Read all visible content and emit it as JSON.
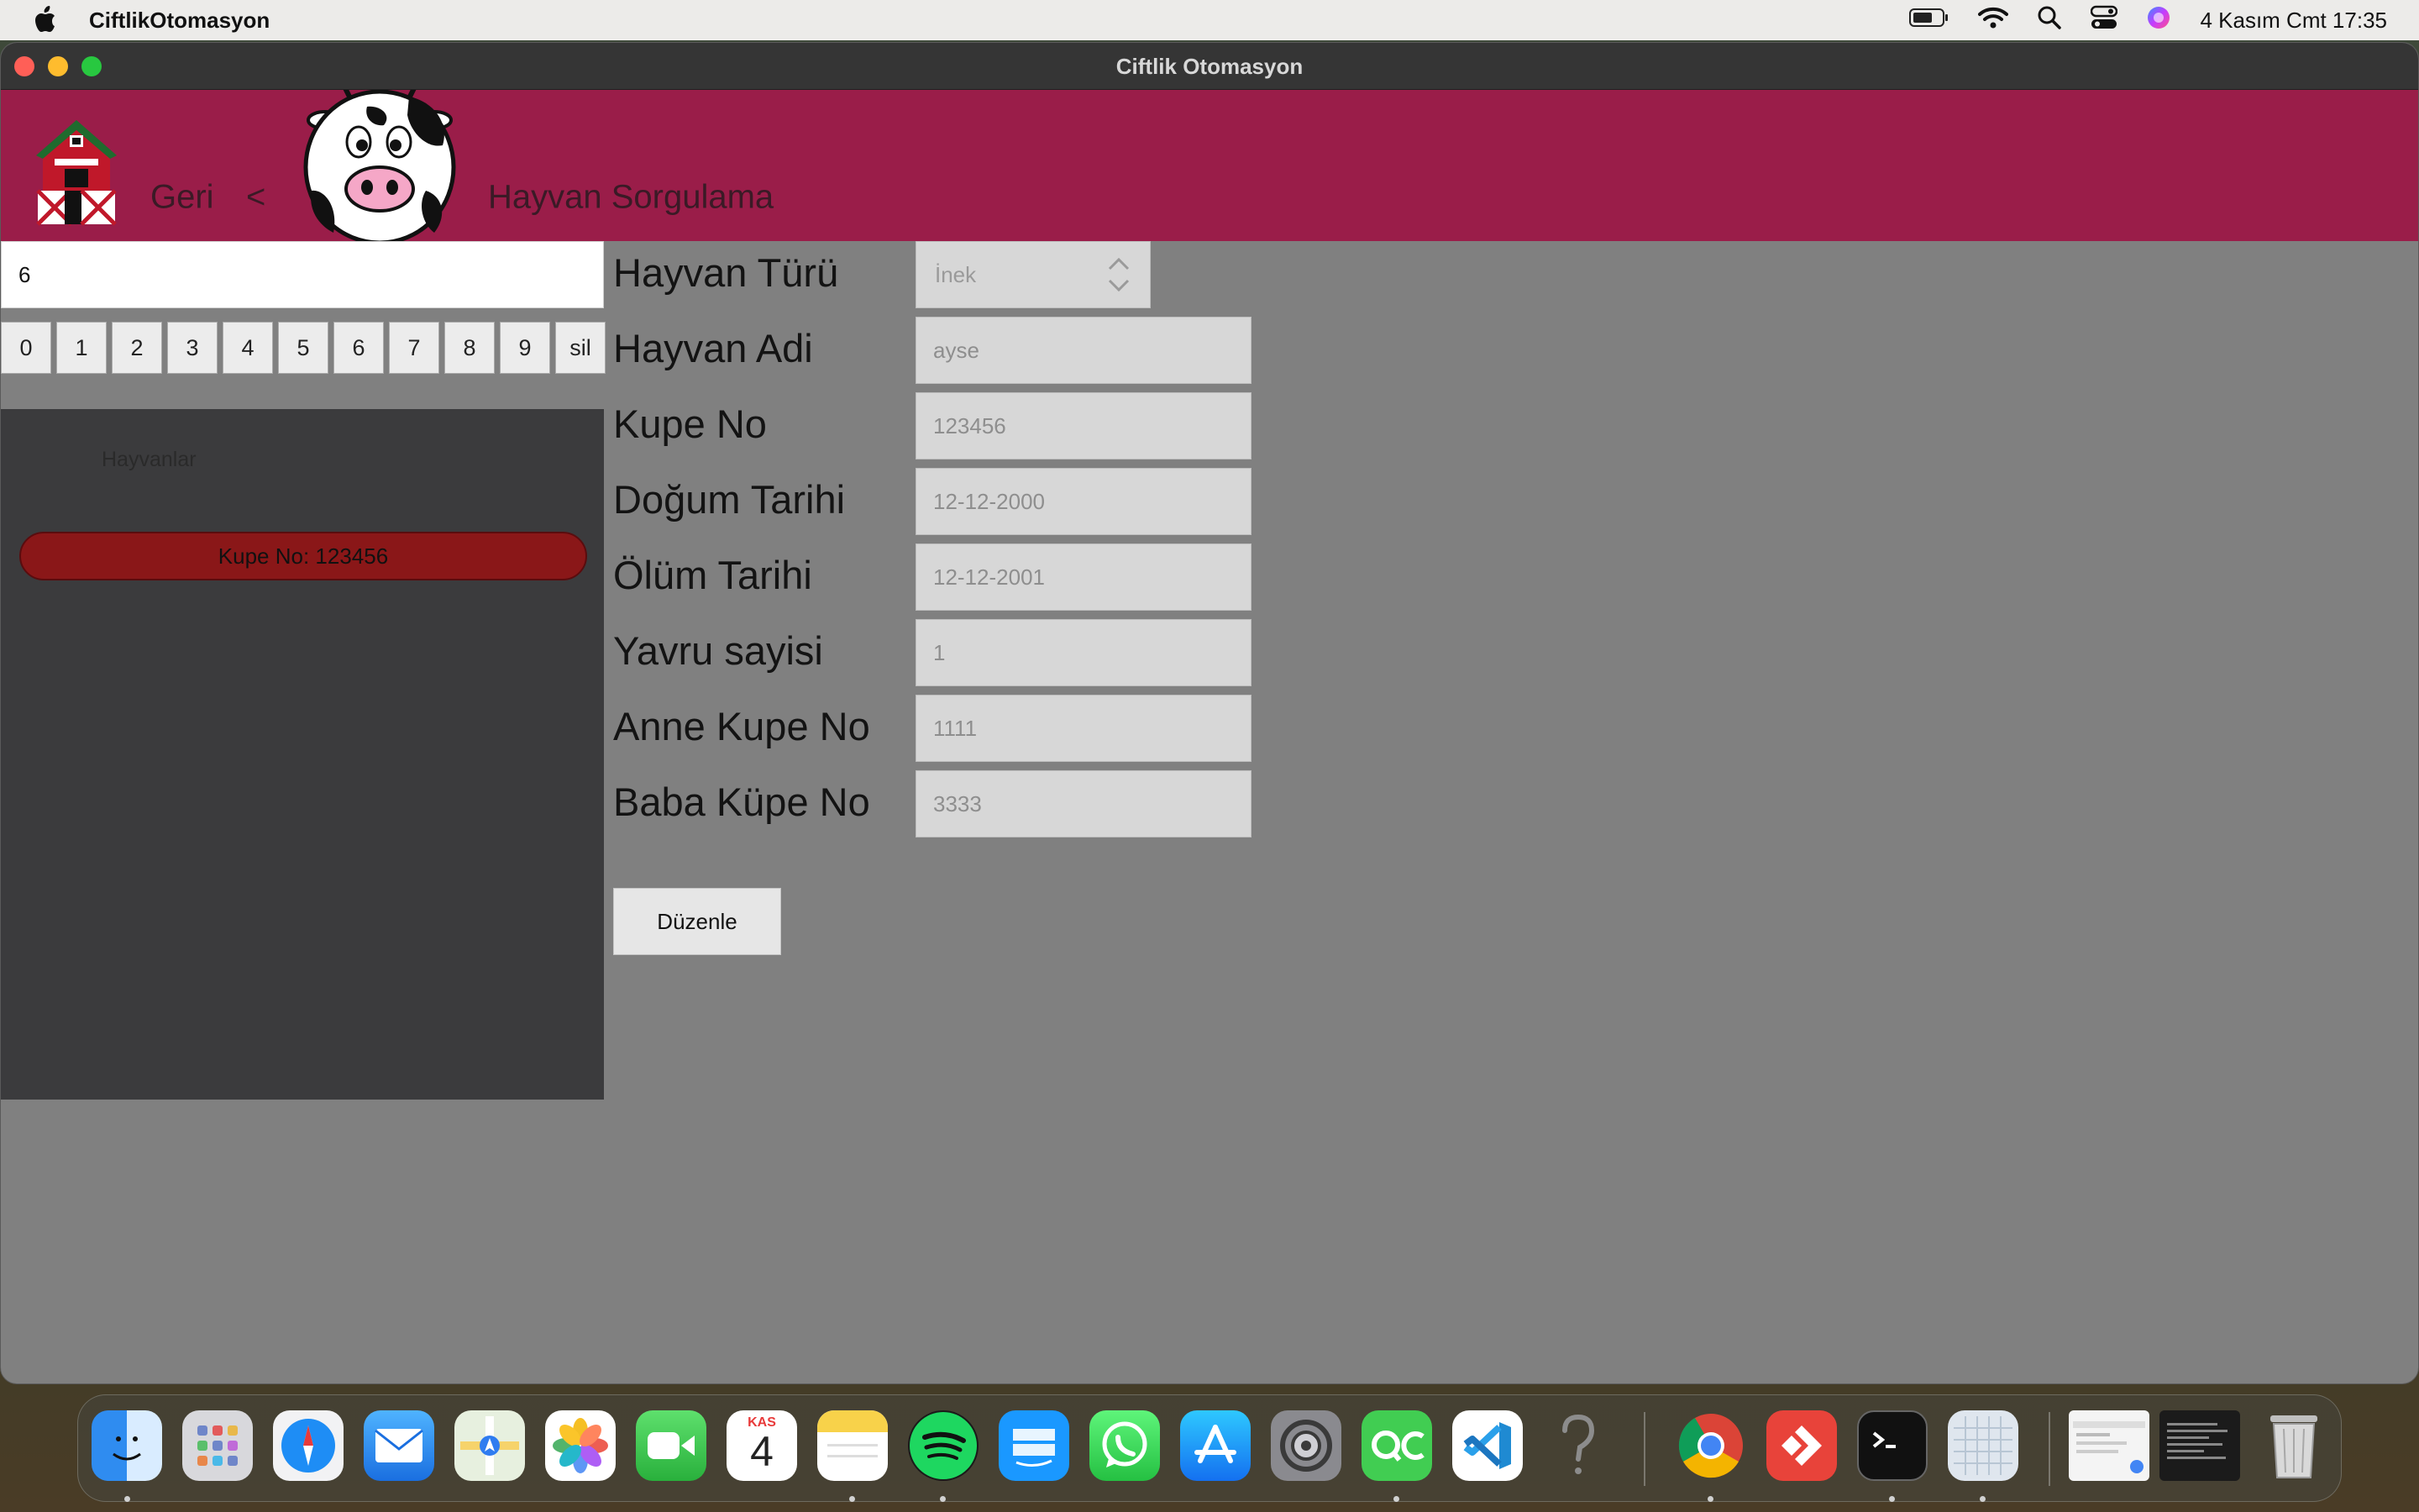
{
  "menubar": {
    "app_name": "CiftlikOtomasyon",
    "datetime": "4 Kasım Cmt  17:35"
  },
  "window": {
    "title": "Ciftlik Otomasyon"
  },
  "header": {
    "back_label": "Geri",
    "back_chevron": "<",
    "page_title": "Hayvan Sorgulama"
  },
  "search": {
    "value": "6"
  },
  "keypad": {
    "keys": [
      "0",
      "1",
      "2",
      "3",
      "4",
      "5",
      "6",
      "7",
      "8",
      "9",
      "sil"
    ]
  },
  "animal_list": {
    "title": "Hayvanlar",
    "items": [
      "Kupe No: 123456"
    ]
  },
  "form": {
    "type_label": "Hayvan Türü",
    "type_value": "İnek",
    "fields": [
      {
        "label": "Hayvan Adi",
        "value": "ayse"
      },
      {
        "label": "Kupe No",
        "value": "123456"
      },
      {
        "label": "Doğum Tarihi",
        "value": "12-12-2000"
      },
      {
        "label": "Ölüm Tarihi",
        "value": "12-12-2001"
      },
      {
        "label": "Yavru sayisi",
        "value": "1"
      },
      {
        "label": "Anne Kupe No",
        "value": "1111"
      },
      {
        "label": "Baba Küpe No",
        "value": "3333"
      }
    ],
    "edit_button": "Düzenle"
  },
  "calendar_icon": {
    "month": "KAS",
    "day": "4"
  },
  "icons": {
    "apple": "apple-icon",
    "battery": "battery-icon",
    "wifi": "wifi-icon",
    "search": "search-icon",
    "control_center": "control-center-icon",
    "siri": "siri-icon",
    "barn": "barn-icon",
    "cow": "cow-icon"
  },
  "colors": {
    "header": "#9a1d49",
    "window_bg": "#808080",
    "list_panel": "#3b3b3d",
    "record_pill": "#8a1718"
  }
}
